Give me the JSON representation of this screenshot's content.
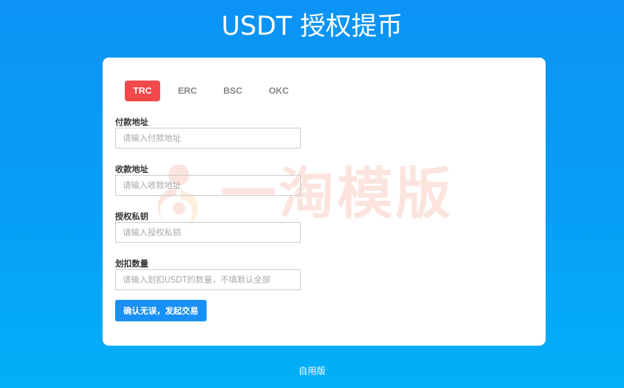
{
  "header": {
    "title": "USDT 授权提币"
  },
  "tabs": [
    {
      "label": "TRC",
      "active": true
    },
    {
      "label": "ERC",
      "active": false
    },
    {
      "label": "BSC",
      "active": false
    },
    {
      "label": "OKC",
      "active": false
    }
  ],
  "form": {
    "pay_address": {
      "label": "付款地址",
      "placeholder": "请输入付款地址",
      "value": ""
    },
    "receive_address": {
      "label": "收款地址",
      "placeholder": "请输入收款地址",
      "value": ""
    },
    "private_key": {
      "label": "授权私钥",
      "placeholder": "请输入授权私钥",
      "value": ""
    },
    "amount": {
      "label": "划扣数量",
      "placeholder": "请输入划扣USDT的数量，不填默认全部",
      "value": ""
    },
    "submit_label": "确认无误，发起交易"
  },
  "watermark": {
    "text": "一淘模版",
    "icon": "yitao-logo-icon"
  },
  "footer": {
    "text": "自用版"
  },
  "colors": {
    "background_top": "#0b93f5",
    "background_bottom": "#02b0f8",
    "active_tab": "#f24a4a",
    "button": "#1890f5",
    "watermark": "#f0603a"
  }
}
